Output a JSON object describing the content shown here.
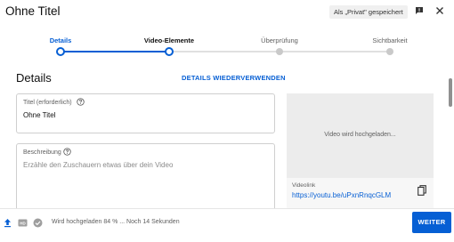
{
  "header": {
    "title": "Ohne Titel",
    "saved_status": "Als „Privat\" gespeichert",
    "feedback_icon": "feedback-icon",
    "close_icon": "close-icon"
  },
  "stepper": {
    "steps": [
      {
        "label": "Details",
        "state": "active"
      },
      {
        "label": "Video-Elemente",
        "state": "done"
      },
      {
        "label": "Überprüfung",
        "state": "todo"
      },
      {
        "label": "Sichtbarkeit",
        "state": "todo"
      }
    ]
  },
  "main": {
    "section_title": "Details",
    "reuse_link": "DETAILS WIEDERVERWENDEN",
    "title_field": {
      "label": "Titel (erforderlich)",
      "value": "Ohne Titel"
    },
    "description_field": {
      "label": "Beschreibung",
      "placeholder": "Erzähle den Zuschauern etwas über dein Video"
    }
  },
  "preview": {
    "status_text": "Video wird hochgeladen...",
    "link_label": "Videolink",
    "link_url": "https://youtu.be/uPxnRnqcGLM"
  },
  "footer": {
    "upload_status": "Wird hochgeladen 84 % ... Noch 14 Sekunden",
    "upload_progress_percent": 84,
    "next_label": "WEITER"
  },
  "colors": {
    "accent": "#065fd4",
    "inactive": "#c9c9c9"
  }
}
